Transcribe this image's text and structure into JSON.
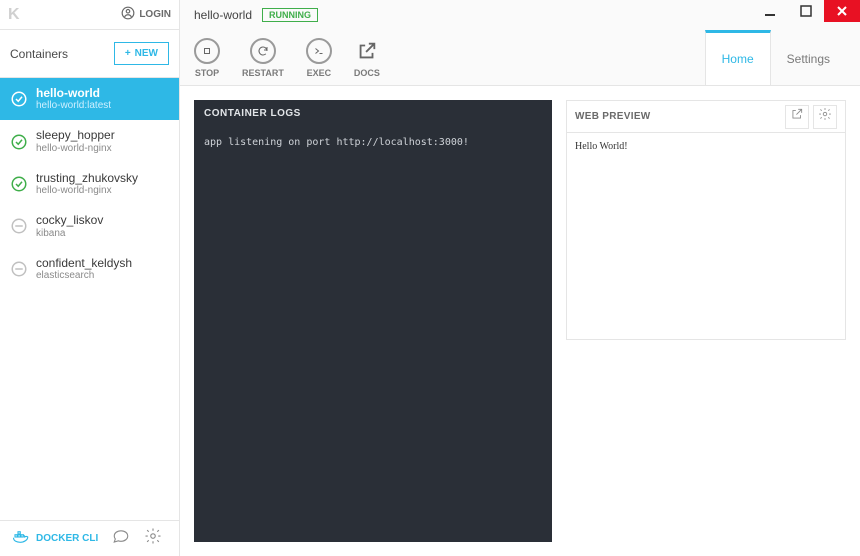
{
  "window": {
    "title": "hello-world",
    "status": "RUNNING"
  },
  "login_label": "LOGIN",
  "sidebar": {
    "title": "Containers",
    "new_label": "NEW",
    "items": [
      {
        "name": "hello-world",
        "image": "hello-world:latest",
        "state": "running-active"
      },
      {
        "name": "sleepy_hopper",
        "image": "hello-world-nginx",
        "state": "running"
      },
      {
        "name": "trusting_zhukovsky",
        "image": "hello-world-nginx",
        "state": "running"
      },
      {
        "name": "cocky_liskov",
        "image": "kibana",
        "state": "stopped"
      },
      {
        "name": "confident_keldysh",
        "image": "elasticsearch",
        "state": "stopped"
      }
    ]
  },
  "actions": {
    "stop": "STOP",
    "restart": "RESTART",
    "exec": "EXEC",
    "docs": "DOCS"
  },
  "tabs": {
    "home": "Home",
    "settings": "Settings"
  },
  "logs": {
    "header": "CONTAINER LOGS",
    "body": "app listening on port http://localhost:3000!"
  },
  "preview": {
    "header": "WEB PREVIEW",
    "body": "Hello World!"
  },
  "bottom": {
    "cli": "DOCKER CLI"
  }
}
